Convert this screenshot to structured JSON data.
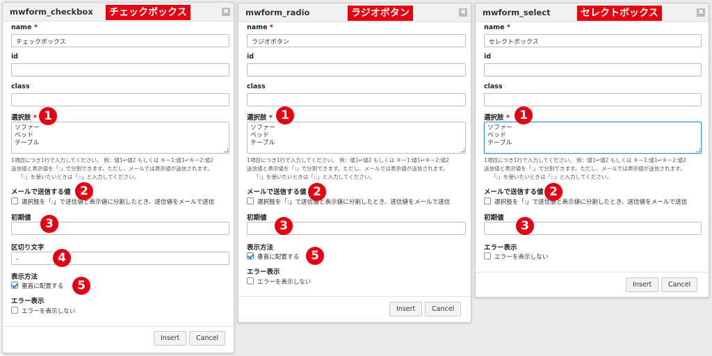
{
  "colors": {
    "accent": "#e60012",
    "focus": "#3b8fd6"
  },
  "icons": {
    "close": "close-icon",
    "check": "checkmark-icon"
  },
  "dialogs": [
    {
      "title": "mwform_checkbox",
      "label": "チェックボックス",
      "close": "✖",
      "fields": {
        "name_label": "name",
        "name_value": "チェックボックス",
        "id_label": "id",
        "class_label": "class",
        "choices_label": "選択肢",
        "choices": [
          "ソファー",
          "ベッド",
          "テーブル"
        ],
        "help": [
          "1項目につき1行で入力してください。 例：値1↵値2 もしくは キー1:値1↵キー2:値2",
          "送信値と表示値を「:」で分割できます。ただし、メールでは表示値が送信されます。",
          "「:」を使いたいときは「::」と入力してください。"
        ],
        "send_label": "メールで送信する値",
        "send_text": "選択肢を「:」で送信値と表示値に分割したとき、送信値をメールで送信",
        "initial_label": "初期値",
        "delimiter_label": "区切り文字",
        "delimiter_value": ",",
        "display_label": "表示方法",
        "vertical_text": "垂直に配置する",
        "error_label": "エラー表示",
        "error_text": "エラーを表示しない"
      },
      "buttons": {
        "insert": "Insert",
        "cancel": "Cancel"
      }
    },
    {
      "title": "mwform_radio",
      "label": "ラジオボタン",
      "close": "✖",
      "fields": {
        "name_label": "name",
        "name_value": "ラジオボタン",
        "id_label": "id",
        "class_label": "class",
        "choices_label": "選択肢",
        "choices": [
          "ソファー",
          "ベッド",
          "テーブル"
        ],
        "help": [
          "1項目につき1行で入力してください。 例：値1↵値2 もしくは キー1:値1↵キー2:値2",
          "送信値と表示値を「:」で分割できます。ただし、メールでは表示値が送信されます。",
          "「:」を使いたいときは「::」と入力してください。"
        ],
        "send_label": "メールで送信する値",
        "send_text": "選択肢を「:」で送信値と表示値に分割したとき、送信値をメールで送信",
        "initial_label": "初期値",
        "display_label": "表示方法",
        "vertical_text": "垂直に配置する",
        "error_label": "エラー表示",
        "error_text": "エラーを表示しない"
      },
      "buttons": {
        "insert": "Insert",
        "cancel": "Cancel"
      }
    },
    {
      "title": "mwform_select",
      "label": "セレクトボックス",
      "close": "✖",
      "fields": {
        "name_label": "name",
        "name_value": "セレクトボックス",
        "id_label": "id",
        "class_label": "class",
        "choices_label": "選択肢",
        "choices": [
          "ソファー",
          "ベッド",
          "テーブル"
        ],
        "help": [
          "1項目につき1行で入力してください。 例：値1↵値2 もしくは キー1:値1↵キー2:値2",
          "送信値と表示値を「:」で分割できます。ただし、メールでは表示値が送信されます。",
          "「:」を使いたいときは「::」と入力してください。"
        ],
        "send_label": "メールで送信する値",
        "send_text": "選択肢を「:」で送信値と表示値に分割したとき、送信値をメールで送信",
        "initial_label": "初期値",
        "error_label": "エラー表示",
        "error_text": "エラーを表示しない"
      },
      "buttons": {
        "insert": "Insert",
        "cancel": "Cancel"
      }
    }
  ],
  "markers": {
    "m1": "1",
    "m2": "2",
    "m3": "3",
    "m4": "4",
    "m5": "5"
  },
  "req_mark": "*"
}
